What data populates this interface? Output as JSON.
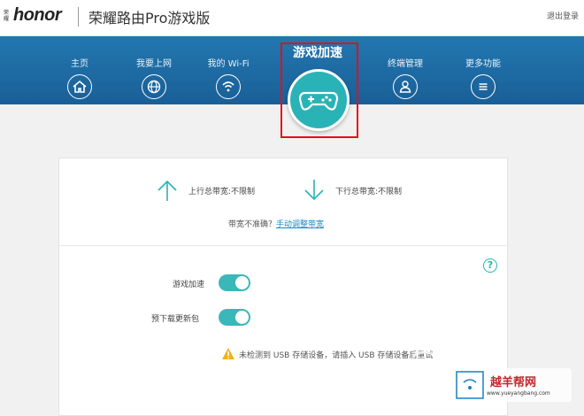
{
  "header": {
    "brand_small": "荣耀",
    "brand": "honor",
    "product": "荣耀路由Pro游戏版",
    "logout": "退出登录"
  },
  "nav": {
    "items": [
      {
        "label": "主页",
        "icon": "home-icon"
      },
      {
        "label": "我要上网",
        "icon": "globe-icon"
      },
      {
        "label": "我的 Wi-Fi",
        "icon": "wifi-icon"
      },
      {
        "label": "游戏加速",
        "icon": "gamepad-icon",
        "active": true
      },
      {
        "label": "终端管理",
        "icon": "user-icon"
      },
      {
        "label": "更多功能",
        "icon": "menu-icon"
      }
    ]
  },
  "bandwidth": {
    "upload": "上行总带宽:不限制",
    "download": "下行总带宽:不限制",
    "hint_prefix": "带宽不准确？",
    "hint_link": "手动调整带宽"
  },
  "settings": {
    "game_accel": {
      "label": "游戏加速",
      "on": true
    },
    "predownload": {
      "label": "预下载更新包",
      "on": true
    }
  },
  "warning": "未检测到 USB 存储设备，请插入 USB 存储设备后重试",
  "watermark": {
    "site_cn": "越羊帮网",
    "site_url": "www.yueyangbang.com"
  },
  "colors": {
    "nav": "#1d6aa5",
    "accent": "#2ab3b6",
    "highlight": "#e3101a"
  }
}
